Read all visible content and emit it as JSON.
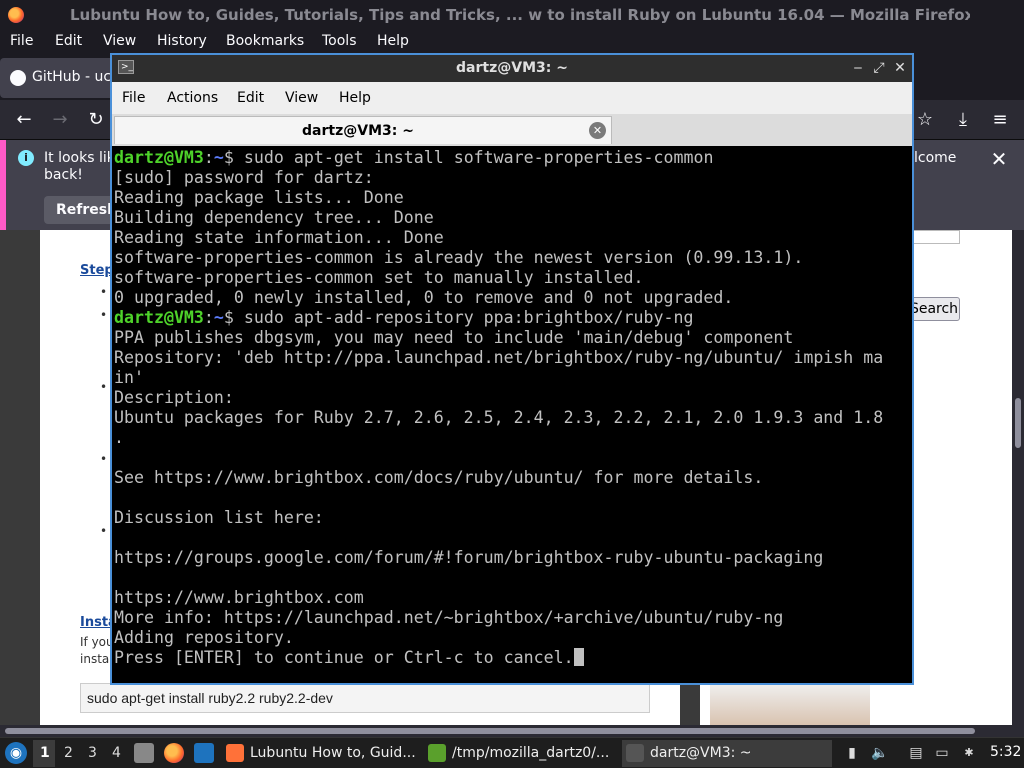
{
  "firefox": {
    "window_title": "Lubuntu How to, Guides, Tutorials, Tips and Tricks, ...  w to install Ruby on Lubuntu 16.04 — Mozilla Firefox",
    "menu": [
      "File",
      "Edit",
      "View",
      "History",
      "Bookmarks",
      "Tools",
      "Help"
    ],
    "tab_label": "GitHub - ucr",
    "infobar": {
      "line1": "It looks lik",
      "line2": "back!",
      "line_right": "lcome",
      "refresh_label": "Refresh"
    }
  },
  "page": {
    "step_link": "Step",
    "install_link": "Insta",
    "if_you": "If you",
    "instal": "instal",
    "code_line": "sudo apt-get install ruby2.2 ruby2.2-dev",
    "search_button": "Search"
  },
  "terminal": {
    "title": "dartz@VM3: ~",
    "menu": [
      "File",
      "Actions",
      "Edit",
      "View",
      "Help"
    ],
    "tab_label": "dartz@VM3: ~",
    "prompt_user": "dartz@VM3",
    "prompt_path": "~",
    "lines": [
      {
        "prompt": true,
        "text": "$ sudo apt-get install software-properties-common"
      },
      {
        "prompt": false,
        "text": "[sudo] password for dartz:"
      },
      {
        "prompt": false,
        "text": "Reading package lists... Done"
      },
      {
        "prompt": false,
        "text": "Building dependency tree... Done"
      },
      {
        "prompt": false,
        "text": "Reading state information... Done"
      },
      {
        "prompt": false,
        "text": "software-properties-common is already the newest version (0.99.13.1)."
      },
      {
        "prompt": false,
        "text": "software-properties-common set to manually installed."
      },
      {
        "prompt": false,
        "text": "0 upgraded, 0 newly installed, 0 to remove and 0 not upgraded."
      },
      {
        "prompt": true,
        "text": "$ sudo apt-add-repository ppa:brightbox/ruby-ng"
      },
      {
        "prompt": false,
        "text": "PPA publishes dbgsym, you may need to include 'main/debug' component"
      },
      {
        "prompt": false,
        "text": "Repository: 'deb http://ppa.launchpad.net/brightbox/ruby-ng/ubuntu/ impish ma"
      },
      {
        "prompt": false,
        "text": "in'"
      },
      {
        "prompt": false,
        "text": "Description:"
      },
      {
        "prompt": false,
        "text": "Ubuntu packages for Ruby 2.7, 2.6, 2.5, 2.4, 2.3, 2.2, 2.1, 2.0 1.9.3 and 1.8"
      },
      {
        "prompt": false,
        "text": "."
      },
      {
        "prompt": false,
        "text": ""
      },
      {
        "prompt": false,
        "text": "See https://www.brightbox.com/docs/ruby/ubuntu/ for more details."
      },
      {
        "prompt": false,
        "text": ""
      },
      {
        "prompt": false,
        "text": "Discussion list here:"
      },
      {
        "prompt": false,
        "text": ""
      },
      {
        "prompt": false,
        "text": "https://groups.google.com/forum/#!forum/brightbox-ruby-ubuntu-packaging"
      },
      {
        "prompt": false,
        "text": ""
      },
      {
        "prompt": false,
        "text": "https://www.brightbox.com"
      },
      {
        "prompt": false,
        "text": "More info: https://launchpad.net/~brightbox/+archive/ubuntu/ruby-ng"
      },
      {
        "prompt": false,
        "text": "Adding repository."
      },
      {
        "prompt": false,
        "text": "Press [ENTER] to continue or Ctrl-c to cancel.",
        "cursor": true
      }
    ]
  },
  "taskbar": {
    "workspaces": [
      "1",
      "2",
      "3",
      "4"
    ],
    "tasks": [
      {
        "label": "Lubuntu How to, Guid...",
        "icon_color": "#ff7139"
      },
      {
        "label": "/tmp/mozilla_dartz0/...",
        "icon_color": "#5aa02c"
      },
      {
        "label": "dartz@VM3: ~",
        "icon_color": "#555555"
      }
    ],
    "clock": "5:32"
  },
  "colors": {
    "terminal_prompt_user": "#4ed32a",
    "terminal_prompt_path": "#5c7cfa",
    "terminal_focus_border": "#4a90d9",
    "infobar_accent": "#ff5ac8"
  }
}
